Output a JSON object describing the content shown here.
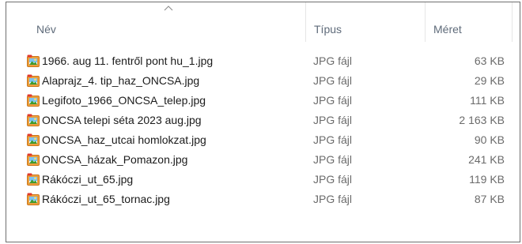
{
  "columns": {
    "name": "Név",
    "type": "Típus",
    "size": "Méret"
  },
  "sort": {
    "column": "name",
    "icon": "chevron-up-icon"
  },
  "file_icon": "jpg-photo-icon",
  "files": [
    {
      "name": "1966. aug 11. fentről pont hu_1.jpg",
      "type": "JPG fájl",
      "size": "63 KB"
    },
    {
      "name": "Alaprajz_4. tip_haz_ONCSA.jpg",
      "type": "JPG fájl",
      "size": "29 KB"
    },
    {
      "name": "Legifoto_1966_ONCSA_telep.jpg",
      "type": "JPG fájl",
      "size": "111 KB"
    },
    {
      "name": "ONCSA telepi séta 2023 aug.jpg",
      "type": "JPG fájl",
      "size": "2 163 KB"
    },
    {
      "name": "ONCSA_haz_utcai homlokzat.jpg",
      "type": "JPG fájl",
      "size": "90 KB"
    },
    {
      "name": "ONCSA_házak_Pomazon.jpg",
      "type": "JPG fájl",
      "size": "241 KB"
    },
    {
      "name": "Rákóczi_ut_65.jpg",
      "type": "JPG fájl",
      "size": "119 KB"
    },
    {
      "name": "Rákóczi_ut_65_tornac.jpg",
      "type": "JPG fájl",
      "size": "87 KB"
    }
  ]
}
